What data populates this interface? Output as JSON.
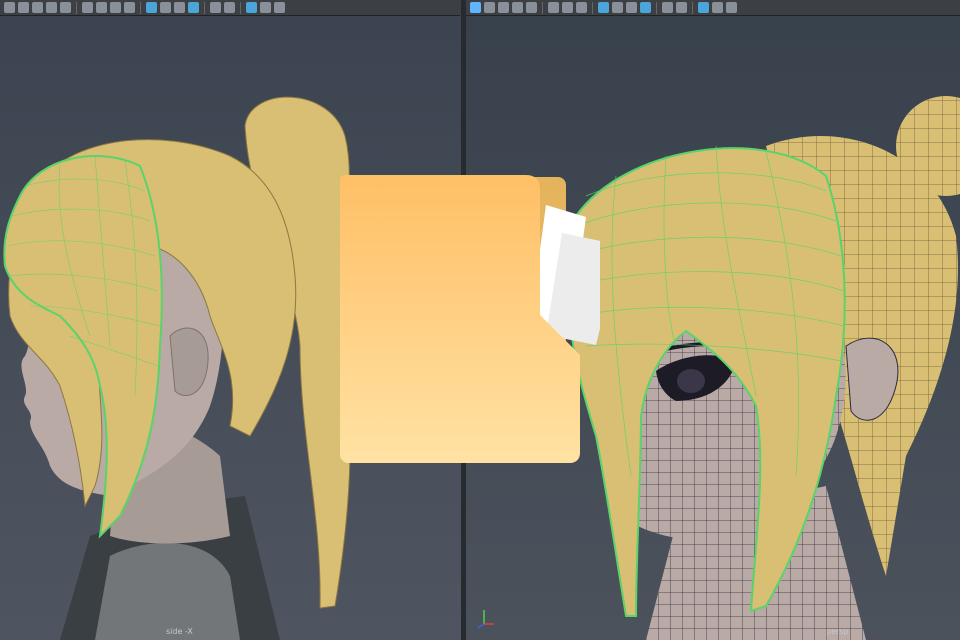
{
  "viewports": {
    "left": {
      "label": "side -X"
    },
    "right": {
      "label": "persp"
    }
  },
  "toolbar": {
    "left_icons": [
      "camera-icon",
      "select-camera-icon",
      "lock-camera-icon",
      "bookmark-icon",
      "image-plane-icon",
      "sep",
      "grid-icon",
      "film-gate-icon",
      "resolution-gate-icon",
      "safe-area-icon",
      "sep",
      "wireframe-icon",
      "smooth-shade-icon",
      "default-material-icon",
      "xray-icon",
      "sep",
      "shadows-icon",
      "ambient-occlusion-icon",
      "sep",
      "isolate-select-icon",
      "xray-joints-icon",
      "exposure-icon"
    ],
    "right_icons": [
      "all-icon",
      "frame-icon",
      "camera-icon",
      "select-camera-icon",
      "bookmark-icon",
      "sep",
      "grid-icon",
      "film-gate-icon",
      "resolution-gate-icon",
      "sep",
      "wireframe-icon",
      "smooth-shade-icon",
      "default-material-icon",
      "xray-icon",
      "sep",
      "shadows-icon",
      "lights-icon",
      "sep",
      "isolate-select-icon",
      "xray-joints-icon",
      "exposure-icon"
    ]
  },
  "overlay": {
    "icon": "folder-icon"
  },
  "colors": {
    "hair": "#d8bf74",
    "hair_dark": "#b89e55",
    "skin": "#b9aaa6",
    "wire": "#2c2a3e",
    "selection": "#5ad36b",
    "folder_top": "#ffbf66",
    "folder_bottom": "#ffe2a3"
  }
}
